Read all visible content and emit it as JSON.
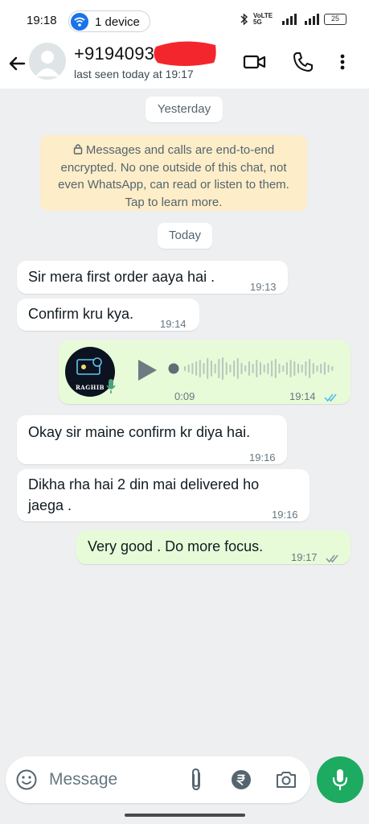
{
  "status_bar": {
    "time": "19:18",
    "device_pill": "1 device",
    "battery": "25",
    "network": "VoLTE 5G"
  },
  "header": {
    "contact_name": "+9194093",
    "last_seen": "last seen today at 19:17",
    "icons": [
      "back-arrow-icon",
      "video-call-icon",
      "voice-call-icon",
      "more-options-icon"
    ]
  },
  "chat": {
    "date_yesterday": "Yesterday",
    "encryption_notice": {
      "lock_icon": "lock-icon",
      "lines": [
        "Messages and calls are end-to-end",
        "encrypted. No one outside of this chat, not",
        "even WhatsApp, can read or listen to them.",
        "Tap to learn more."
      ]
    },
    "date_today": "Today",
    "messages": [
      {
        "direction": "in",
        "text": "Sir mera first order aaya hai .",
        "time": "19:13"
      },
      {
        "direction": "in",
        "text": "Confirm kru kya.",
        "time": "19:14"
      },
      {
        "direction": "out",
        "type": "voice",
        "duration": "0:09",
        "time": "19:14",
        "status": "read",
        "thumb_label": "RAGHIB"
      },
      {
        "direction": "in",
        "text": "Okay sir maine confirm kr diya hai.",
        "time": "19:16"
      },
      {
        "direction": "in",
        "text_lines": [
          "Dikha rha hai 2 din mai delivered ho",
          "jaega ."
        ],
        "time": "19:16"
      },
      {
        "direction": "out",
        "text": "Very good . Do more focus.",
        "time": "19:17",
        "status": "delivered"
      }
    ]
  },
  "composer": {
    "placeholder": "Message",
    "icons": [
      "emoji-icon",
      "attach-icon",
      "rupee-icon",
      "camera-icon",
      "mic-icon"
    ]
  },
  "colors": {
    "accent_green": "#1daa61",
    "outgoing_bubble": "#e7fbd8",
    "read_ticks": "#53bdeb",
    "notice_bg": "#fdedc8"
  }
}
